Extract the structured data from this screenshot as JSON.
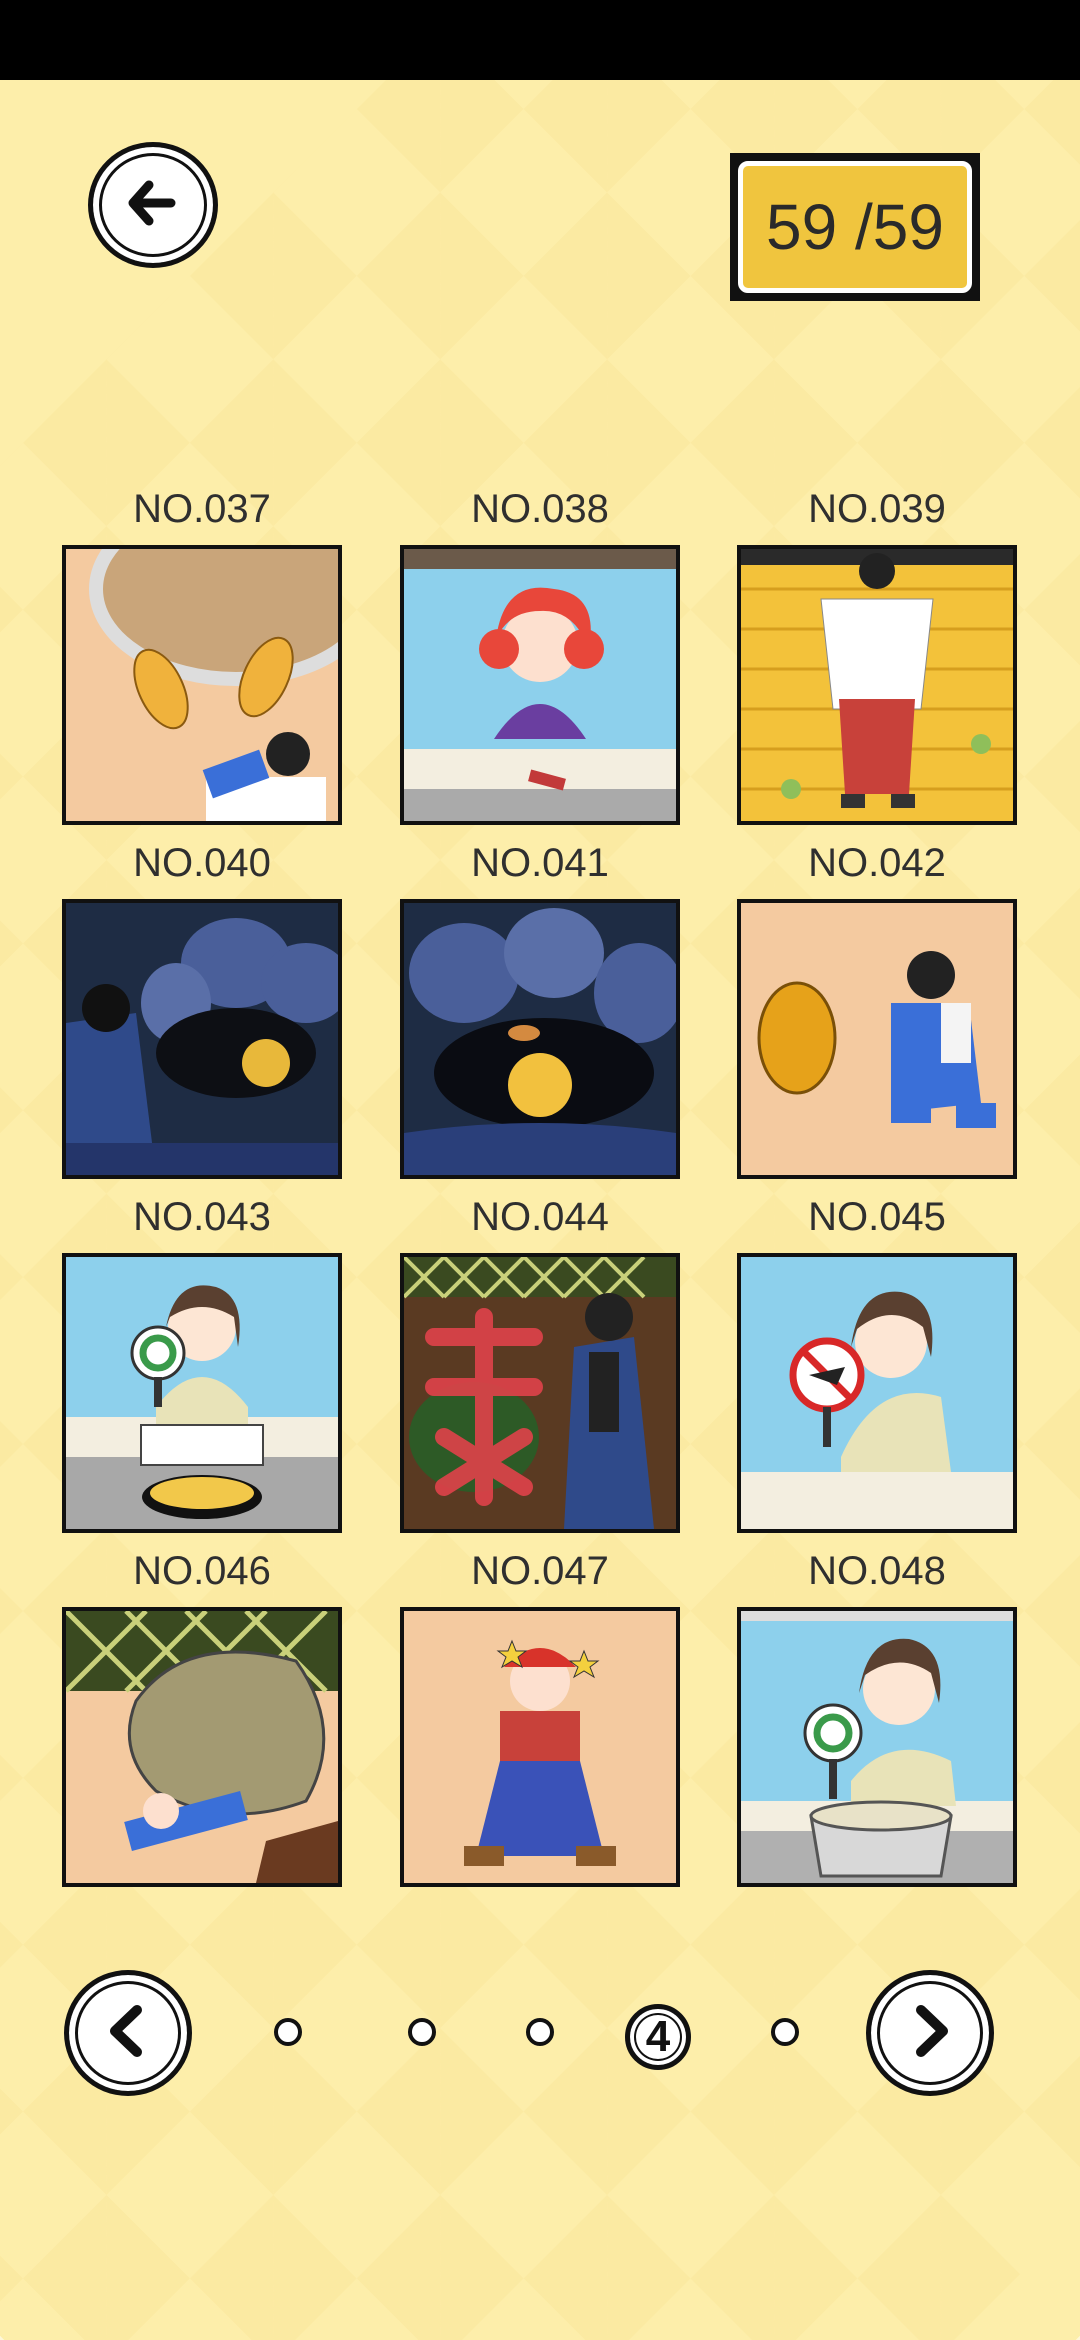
{
  "counter": {
    "text": "59 /59"
  },
  "colors": {
    "background": "#fdeeaa",
    "counter_fill": "#f0c53e"
  },
  "icons": {
    "back": "arrow-left-icon",
    "prev": "chevron-left-icon",
    "next": "chevron-right-icon"
  },
  "grid": [
    {
      "label": "NO.037",
      "scene": "croissants-and-boy"
    },
    {
      "label": "NO.038",
      "scene": "red-haired-girl-at-counter"
    },
    {
      "label": "NO.039",
      "scene": "shrine-maiden-on-stage"
    },
    {
      "label": "NO.040",
      "scene": "night-rocks-with-boy"
    },
    {
      "label": "NO.041",
      "scene": "night-rocks-moon"
    },
    {
      "label": "NO.042",
      "scene": "durian-and-crouching-boy"
    },
    {
      "label": "NO.043",
      "scene": "woman-with-circle-sign-omelette"
    },
    {
      "label": "NO.044",
      "scene": "red-kanji-and-man"
    },
    {
      "label": "NO.045",
      "scene": "woman-with-prohibited-sign"
    },
    {
      "label": "NO.046",
      "scene": "boulder-falling-on-boy"
    },
    {
      "label": "NO.047",
      "scene": "dizzy-plumber"
    },
    {
      "label": "NO.048",
      "scene": "woman-with-circle-sign-pot"
    }
  ],
  "pager": {
    "active_page": "4",
    "page_count": 5
  }
}
